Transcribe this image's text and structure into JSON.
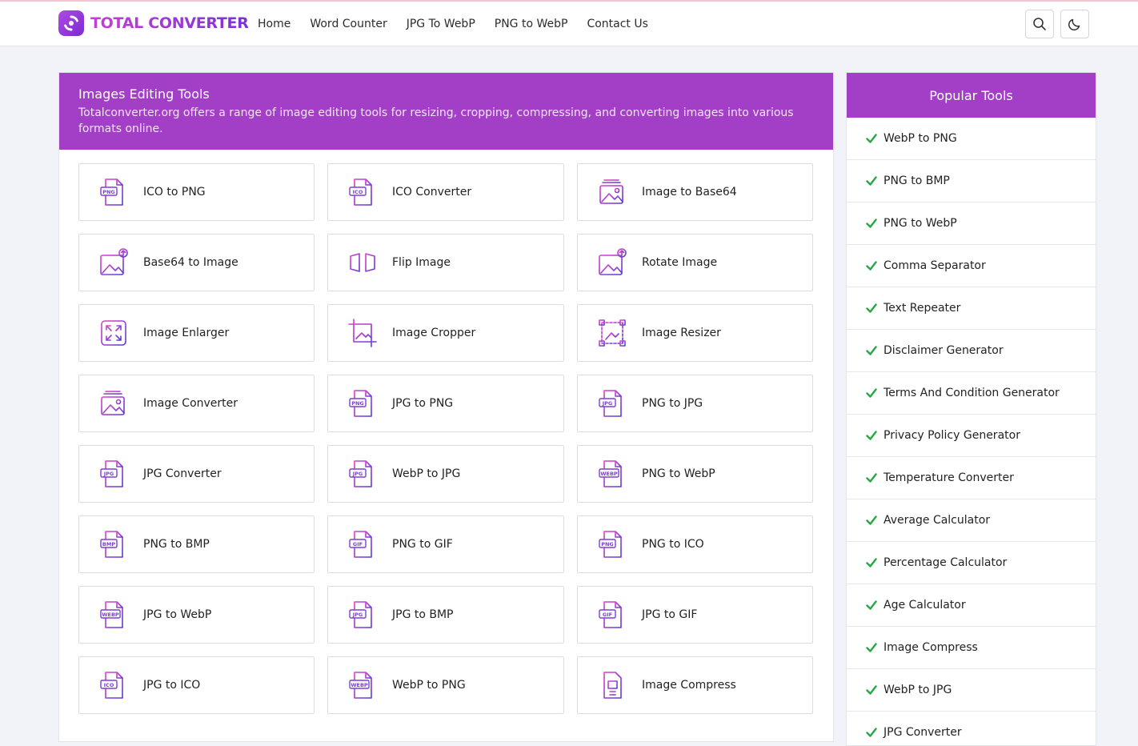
{
  "brand": {
    "name": "TOTAL CONVERTER",
    "accent": "#a23fc6"
  },
  "nav": [
    {
      "label": "Home"
    },
    {
      "label": "Word Counter"
    },
    {
      "label": "JPG To WebP"
    },
    {
      "label": "PNG to WebP"
    },
    {
      "label": "Contact Us"
    }
  ],
  "header_icons": [
    "search-icon",
    "moon-icon"
  ],
  "main": {
    "title": "Images Editing Tools",
    "description": "Totalconverter.org offers a range of image editing tools for resizing, cropping, compressing, and converting images into various formats online.",
    "tools": [
      {
        "label": "ICO to PNG",
        "icon": "file-png-icon",
        "badge": "PNG"
      },
      {
        "label": "ICO Converter",
        "icon": "file-ico-icon",
        "badge": "ICO"
      },
      {
        "label": "Image to Base64",
        "icon": "image-stack-icon",
        "badge": ""
      },
      {
        "label": "Base64 to Image",
        "icon": "image-upload-icon",
        "badge": ""
      },
      {
        "label": "Flip Image",
        "icon": "flip-icon",
        "badge": ""
      },
      {
        "label": "Rotate Image",
        "icon": "rotate-image-icon",
        "badge": ""
      },
      {
        "label": "Image Enlarger",
        "icon": "expand-icon",
        "badge": ""
      },
      {
        "label": "Image Cropper",
        "icon": "crop-icon",
        "badge": ""
      },
      {
        "label": "Image Resizer",
        "icon": "resize-icon",
        "badge": ""
      },
      {
        "label": "Image Converter",
        "icon": "images-icon",
        "badge": ""
      },
      {
        "label": "JPG to PNG",
        "icon": "file-png-icon",
        "badge": "PNG"
      },
      {
        "label": "PNG to JPG",
        "icon": "file-jpg-icon",
        "badge": "JPG"
      },
      {
        "label": "JPG Converter",
        "icon": "file-jpg-icon",
        "badge": "JPG"
      },
      {
        "label": "WebP to JPG",
        "icon": "file-jpg-icon",
        "badge": "JPG"
      },
      {
        "label": "PNG to WebP",
        "icon": "file-webp-icon",
        "badge": "WEBP"
      },
      {
        "label": "PNG to BMP",
        "icon": "file-bmp-icon",
        "badge": "BMP"
      },
      {
        "label": "PNG to GIF",
        "icon": "file-gif-icon",
        "badge": "GIF"
      },
      {
        "label": "PNG to ICO",
        "icon": "file-png-icon",
        "badge": "PNG"
      },
      {
        "label": "JPG to WebP",
        "icon": "file-webp-icon",
        "badge": "WEBP"
      },
      {
        "label": "JPG to BMP",
        "icon": "file-jpg-icon",
        "badge": "JPG"
      },
      {
        "label": "JPG to GIF",
        "icon": "file-gif-icon",
        "badge": "GIF"
      },
      {
        "label": "JPG to ICO",
        "icon": "file-ico-icon",
        "badge": "ICO"
      },
      {
        "label": "WebP to PNG",
        "icon": "file-webp-icon",
        "badge": "WEBP"
      },
      {
        "label": "Image Compress",
        "icon": "compress-icon",
        "badge": ""
      }
    ]
  },
  "sidebar": {
    "title": "Popular Tools",
    "check_color": "#28a745",
    "items": [
      {
        "label": "WebP to PNG"
      },
      {
        "label": "PNG to BMP"
      },
      {
        "label": "PNG to WebP"
      },
      {
        "label": "Comma Separator"
      },
      {
        "label": "Text Repeater"
      },
      {
        "label": "Disclaimer Generator"
      },
      {
        "label": "Terms And Condition Generator"
      },
      {
        "label": "Privacy Policy Generator"
      },
      {
        "label": "Temperature Converter"
      },
      {
        "label": "Average Calculator"
      },
      {
        "label": "Percentage Calculator"
      },
      {
        "label": "Age Calculator"
      },
      {
        "label": "Image Compress"
      },
      {
        "label": "WebP to JPG"
      },
      {
        "label": "JPG Converter"
      }
    ]
  }
}
